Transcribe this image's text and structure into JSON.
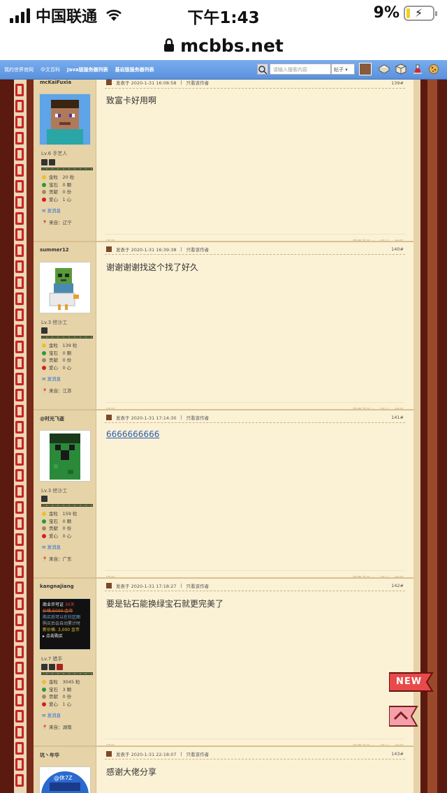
{
  "status": {
    "carrier": "中国联通",
    "time": "下午1:43",
    "battery": "9%"
  },
  "url": "mcbbs.net",
  "nav": {
    "links": [
      "我的世界官网",
      "中文百科",
      "Java版服务器列表",
      "基岩版服务器列表"
    ],
    "search_placeholder": "请输入搜索内容",
    "search_type": "帖子 ▾"
  },
  "posts": [
    {
      "username": "mcKaiFuxia",
      "level": "Lv.6 手艺人",
      "gold": "金粒　20 粒",
      "gem": "宝石　0 颗",
      "contrib": "贡献　0 份",
      "love": "爱心　1 心",
      "pm": "发消息",
      "from": "来自：辽宁",
      "posted": "发表于 2020-1-31 16:08:58",
      "only_author": "只看该作者",
      "floor": "139#",
      "message": "致富卡好用啊",
      "reply": "回复",
      "tools": "使用道具 ▾",
      "rate": "评分",
      "report": "举报"
    },
    {
      "username": "summer12",
      "level": "Lv.3 挖沙工",
      "gold": "金粒　139 粒",
      "gem": "宝石　0 颗",
      "contrib": "贡献　0 份",
      "love": "爱心　0 心",
      "pm": "发消息",
      "from": "来自：江苏",
      "posted": "发表于 2020-1-31 16:39:38",
      "only_author": "只看该作者",
      "floor": "140#",
      "message": "谢谢谢谢找这个找了好久",
      "reply": "回复",
      "tools": "使用道具 ▾",
      "rate": "评分",
      "report": "举报"
    },
    {
      "username": "@时光飞逝",
      "level": "Lv.3 挖沙工",
      "gold": "金粒　159 粒",
      "gem": "宝石　0 颗",
      "contrib": "贡献　0 份",
      "love": "爱心　0 心",
      "pm": "发消息",
      "from": "来自：广东",
      "posted": "发表于 2020-1-31 17:14:30",
      "only_author": "只看该作者",
      "floor": "141#",
      "message": "6666666666",
      "reply": "回复",
      "tools": "使用道具 ▾",
      "rate": "评分",
      "report": "举报"
    },
    {
      "username": "kangnajiang",
      "level": "Lv.7 猎手",
      "gold": "金粒　3045 粒",
      "gem": "宝石　3 颗",
      "contrib": "贡献　0 份",
      "love": "爱心　1 心",
      "pm": "发消息",
      "from": "来自：湖南",
      "posted": "发表于 2020-1-31 17:18:27",
      "only_author": "只看该作者",
      "floor": "142#",
      "message": "要是钻石能换绿宝石就更完美了",
      "reply": "回复",
      "tools": "使用道具 ▾",
      "rate": "评分",
      "report": "举报",
      "avatar_card": {
        "line1": "商业许可证",
        "line1b": "30天",
        "line2": "价格:5000 金币",
        "line3": "购买后可以在社区图",
        "line4": "购买后会自动累计时",
        "line5": "新价格: 3,000 金币",
        "line6": "▸ 点击购买"
      }
    },
    {
      "username": "坑丶年华",
      "posted": "发表于 2020-1-31 22:18:07",
      "only_author": "只看该作者",
      "floor": "143#",
      "message": "感谢大佬分享",
      "avatar_text": "@休7Z"
    }
  ],
  "float": {
    "new_label": "NEW"
  }
}
